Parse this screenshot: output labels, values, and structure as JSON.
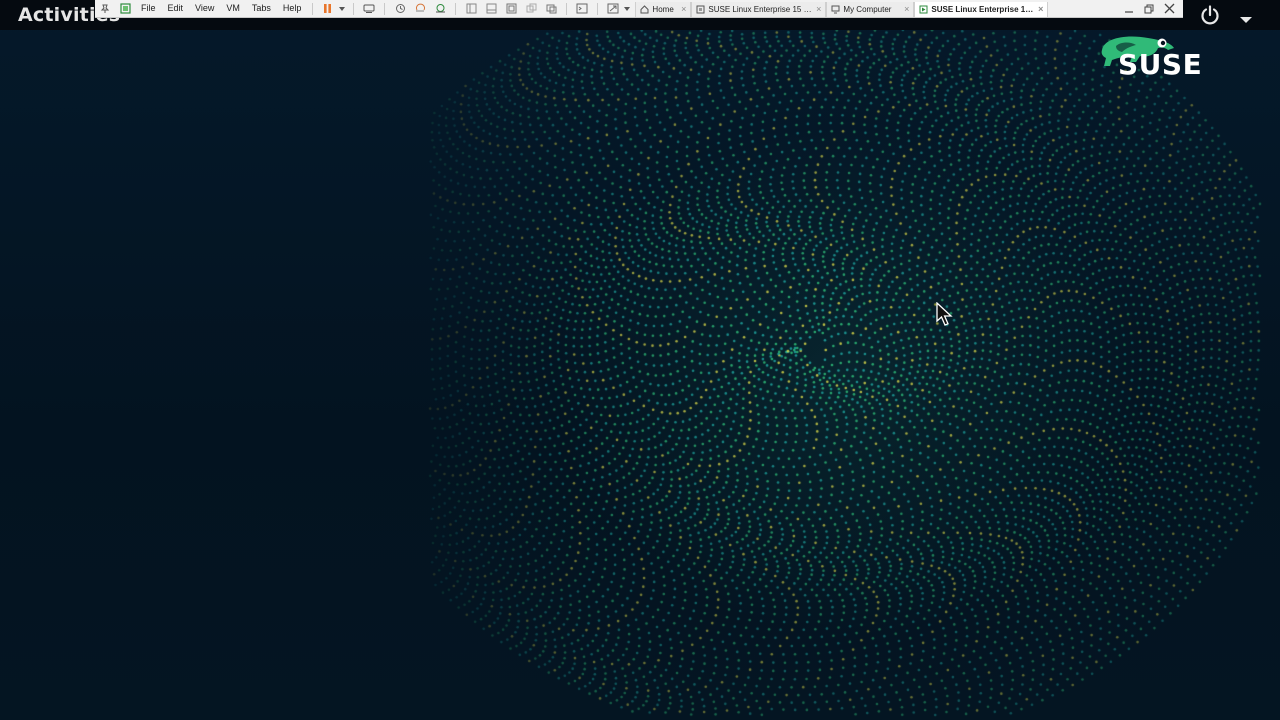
{
  "gnome": {
    "activities_label": "Activities",
    "clock_text": ""
  },
  "vmware": {
    "menu": [
      "File",
      "Edit",
      "View",
      "VM",
      "Tabs",
      "Help"
    ],
    "tabs": [
      {
        "label": "Home",
        "icon": "home-icon",
        "active": false
      },
      {
        "label": "SUSE Linux Enterprise 15 64-...",
        "icon": "vm-icon",
        "active": false
      },
      {
        "label": "My Computer",
        "icon": "computer-icon",
        "active": false
      },
      {
        "label": "SUSE Linux Enterprise 15 ...",
        "icon": "vm-running-icon",
        "active": true
      }
    ],
    "pause_color": "#e8762b"
  },
  "branding": {
    "wordmark": "SUSE",
    "chameleon_color": "#30ba78"
  },
  "colors": {
    "background": "#04121f",
    "swirl_green": "#2fbf7a",
    "swirl_teal": "#1fa6a0",
    "swirl_yellow": "#d8d84a"
  }
}
